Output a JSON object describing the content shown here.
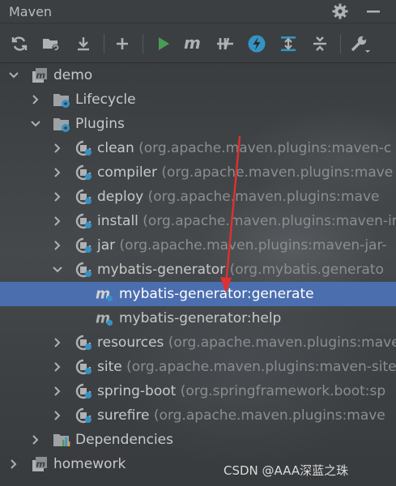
{
  "panel": {
    "title": "Maven"
  },
  "toolbar": {
    "buttons": [
      {
        "icon": "reload-icon"
      },
      {
        "icon": "generate-sources-icon"
      },
      {
        "icon": "download-icon"
      },
      {
        "icon": "add-icon"
      },
      {
        "icon": "run-icon"
      },
      {
        "icon": "execute-goal-icon"
      },
      {
        "icon": "toggle-offline-icon"
      },
      {
        "icon": "skip-tests-icon"
      },
      {
        "icon": "show-dependencies-icon"
      },
      {
        "icon": "collapse-all-icon"
      },
      {
        "icon": "settings-wrench-icon"
      }
    ]
  },
  "tree": {
    "demo": "demo",
    "lifecycle": "Lifecycle",
    "plugins": "Plugins",
    "plugin_items": [
      {
        "name": "clean",
        "coord": "(org.apache.maven.plugins:maven-c"
      },
      {
        "name": "compiler",
        "coord": "(org.apache.maven.plugins:mave"
      },
      {
        "name": "deploy",
        "coord": "(org.apache.maven.plugins:mave"
      },
      {
        "name": "install",
        "coord": "(org.apache.maven.plugins:maven-in"
      },
      {
        "name": "jar",
        "coord": "(org.apache.maven.plugins:maven-jar-"
      },
      {
        "name": "mybatis-generator",
        "coord": "(org.mybatis.generato"
      }
    ],
    "goals": [
      {
        "name": "mybatis-generator:generate"
      },
      {
        "name": "mybatis-generator:help"
      }
    ],
    "plugin_items_after": [
      {
        "name": "resources",
        "coord": "(org.apache.maven.plugins:mave"
      },
      {
        "name": "site",
        "coord": "(org.apache.maven.plugins:maven-site"
      },
      {
        "name": "spring-boot",
        "coord": "(org.springframework.boot:sp"
      },
      {
        "name": "surefire",
        "coord": "(org.apache.maven.plugins:mave"
      }
    ],
    "dependencies": "Dependencies",
    "homework": "homework"
  },
  "watermark": "CSDN @AAA深蓝之珠",
  "colors": {
    "background": "#3c3f41",
    "selection": "#4b6eaf",
    "annotation_arrow": "#e03030",
    "run_green": "#499c54",
    "folder_blue": "#3592c4"
  }
}
